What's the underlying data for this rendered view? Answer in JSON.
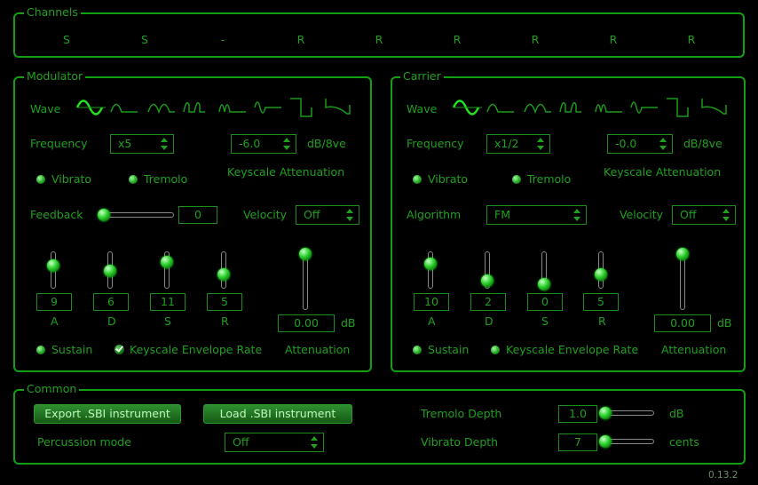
{
  "channels": {
    "title": "Channels",
    "items": [
      "S",
      "S",
      "-",
      "R",
      "R",
      "R",
      "R",
      "R",
      "R"
    ]
  },
  "modulator": {
    "title": "Modulator",
    "wave_label": "Wave",
    "frequency_label": "Frequency",
    "frequency_value": "x5",
    "ksl_value": "-6.0",
    "ksl_unit": "dB/8ve",
    "ksl_label": "Keyscale Attenuation",
    "vibrato_label": "Vibrato",
    "tremolo_label": "Tremolo",
    "feedback_label": "Feedback",
    "feedback_value": "0",
    "feedback_level": 0,
    "velocity_label": "Velocity",
    "velocity_value": "Off",
    "adsr": [
      {
        "label": "A",
        "value": "9",
        "level": 0.6
      },
      {
        "label": "D",
        "value": "6",
        "level": 0.4
      },
      {
        "label": "S",
        "value": "11",
        "level": 0.73
      },
      {
        "label": "R",
        "value": "5",
        "level": 0.33
      }
    ],
    "attenuation_value": "0.00",
    "attenuation_unit": "dB",
    "attenuation_label": "Attenuation",
    "sustain_label": "Sustain",
    "ksr_label": "Keyscale Envelope Rate",
    "ksr_checked": true
  },
  "carrier": {
    "title": "Carrier",
    "wave_label": "Wave",
    "frequency_label": "Frequency",
    "frequency_value": "x1/2",
    "ksl_value": "-0.0",
    "ksl_unit": "dB/8ve",
    "ksl_label": "Keyscale Attenuation",
    "vibrato_label": "Vibrato",
    "tremolo_label": "Tremolo",
    "algorithm_label": "Algorithm",
    "algorithm_value": "FM",
    "velocity_label": "Velocity",
    "velocity_value": "Off",
    "adsr": [
      {
        "label": "A",
        "value": "10",
        "level": 0.67
      },
      {
        "label": "D",
        "value": "2",
        "level": 0.13
      },
      {
        "label": "S",
        "value": "0",
        "level": 0.0
      },
      {
        "label": "R",
        "value": "5",
        "level": 0.33
      }
    ],
    "attenuation_value": "0.00",
    "attenuation_unit": "dB",
    "attenuation_label": "Attenuation",
    "sustain_label": "Sustain",
    "ksr_label": "Keyscale Envelope Rate",
    "ksr_checked": false
  },
  "common": {
    "title": "Common",
    "export_label": "Export .SBI instrument",
    "load_label": "Load .SBI instrument",
    "percussion_label": "Percussion mode",
    "percussion_value": "Off",
    "tremolo_depth_label": "Tremolo Depth",
    "tremolo_depth_value": "1.0",
    "tremolo_depth_unit": "dB",
    "vibrato_depth_label": "Vibrato Depth",
    "vibrato_depth_value": "7",
    "vibrato_depth_unit": "cents"
  },
  "version": "0.13.2",
  "colors": {
    "accent": "#1fa01f",
    "border": "#12a012",
    "background": "#000000"
  },
  "waves": [
    "sine-wave-icon",
    "half-sine-wave-icon",
    "abs-sine-wave-icon",
    "pulse-sine-wave-icon",
    "even-sine-wave-icon",
    "abs-even-sine-wave-icon",
    "square-wave-icon",
    "derived-square-wave-icon"
  ]
}
